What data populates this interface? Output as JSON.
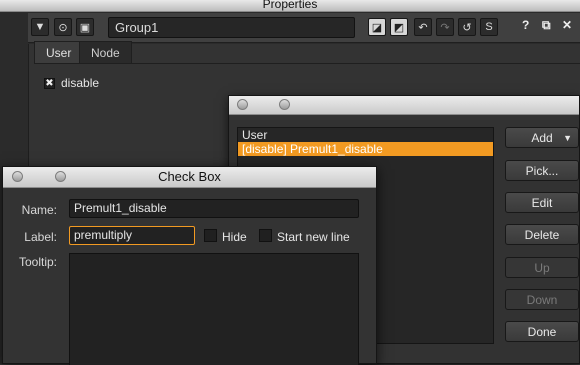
{
  "properties": {
    "window_title": "Properties",
    "node_name": "Group1",
    "toolbar": {
      "question": "?"
    },
    "tabs": [
      {
        "label": "User"
      },
      {
        "label": "Node"
      }
    ],
    "disable_label": "disable",
    "disable_checked": true
  },
  "knobs_dialog": {
    "list": [
      {
        "label": "User",
        "selected": false
      },
      {
        "label": "[disable] Premult1_disable",
        "selected": true
      }
    ],
    "buttons": [
      {
        "label": "Add",
        "enabled": true,
        "dropdown": true
      },
      {
        "label": "Pick...",
        "enabled": true
      },
      {
        "label": "Edit",
        "enabled": true
      },
      {
        "label": "Delete",
        "enabled": true
      },
      {
        "label": "Up",
        "enabled": false
      },
      {
        "label": "Down",
        "enabled": false
      },
      {
        "label": "Done",
        "enabled": true
      }
    ]
  },
  "checkbox_dialog": {
    "title": "Check Box",
    "name_label": "Name:",
    "name_value": "Premult1_disable",
    "label_label": "Label:",
    "label_value": "premultiply",
    "hide_label": "Hide",
    "hide_checked": false,
    "start_new_line_label": "Start new line",
    "start_new_line_checked": false,
    "tooltip_label": "Tooltip:",
    "tooltip_value": ""
  },
  "colors": {
    "accent": "#f29a22"
  }
}
